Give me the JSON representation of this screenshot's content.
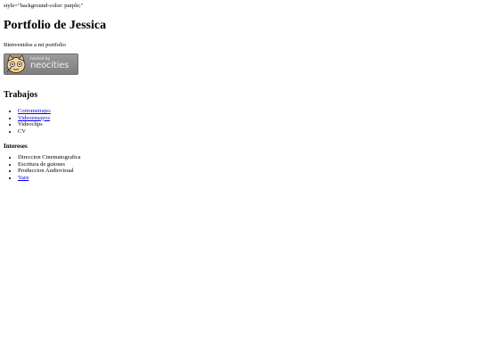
{
  "stray_text": "style=\"background-color: purple;\"",
  "title": "Portfolio de Jessica",
  "welcome": "Bienvenidos a mi portfolio",
  "badge": {
    "hosted_by": "hosted by",
    "brand": "neocities",
    "icon": "neocities-cat-icon"
  },
  "trabajos": {
    "heading": "Trabajos",
    "items": [
      {
        "label": "Cortometrajes",
        "is_link": true
      },
      {
        "label": "Videoensayos",
        "is_link": true
      },
      {
        "label": "Videoclips",
        "is_link": false
      },
      {
        "label": "CV",
        "is_link": false
      }
    ]
  },
  "intereses": {
    "heading": "Intereses",
    "items": [
      {
        "label": "Direccion Cinematografica",
        "is_link": false
      },
      {
        "label": "Escritura de guiones",
        "is_link": false
      },
      {
        "label": "Produccion Audiovisual",
        "is_link": false
      },
      {
        "label": "Yarn",
        "is_link": true
      }
    ]
  }
}
